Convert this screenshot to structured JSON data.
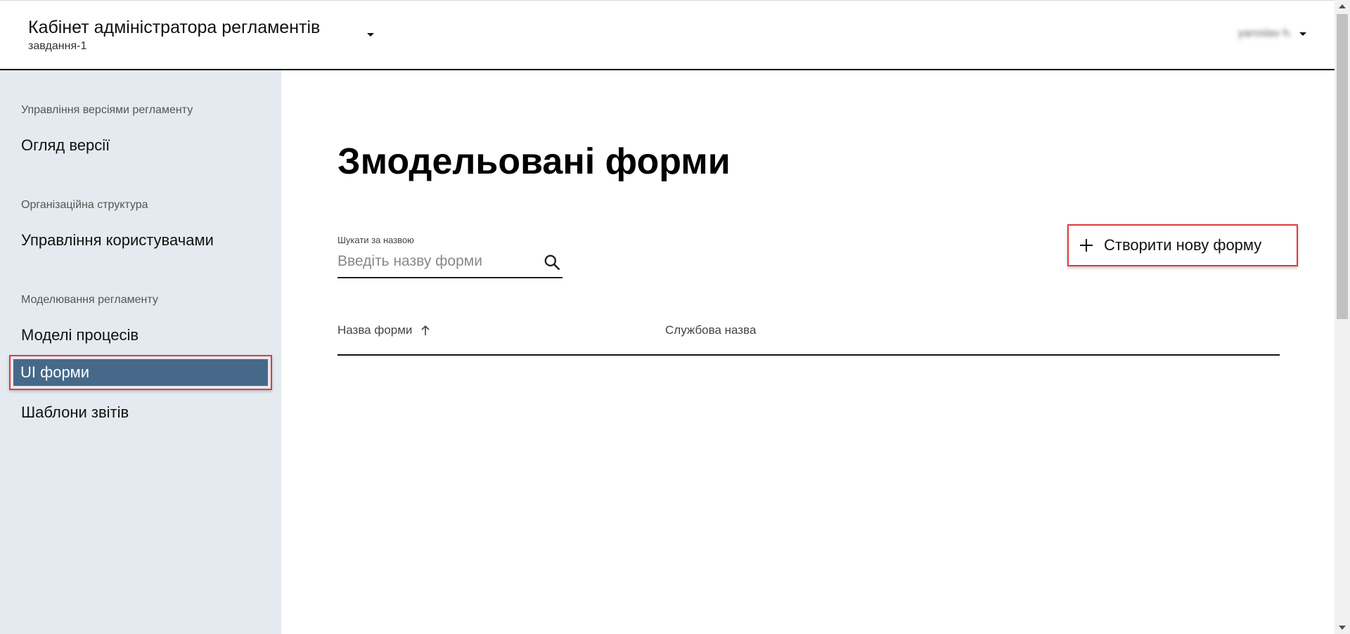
{
  "header": {
    "title": "Кабінет адміністратора регламентів",
    "subtitle": "завдання-1",
    "user_name": "yaroslav h."
  },
  "sidebar": {
    "sections": [
      {
        "title": "Управління версіями регламенту",
        "items": [
          "Огляд версії"
        ]
      },
      {
        "title": "Організаційна структура",
        "items": [
          "Управління користувачами"
        ]
      },
      {
        "title": "Моделювання регламенту",
        "items": [
          "Моделі процесів",
          "UI форми",
          "Шаблони звітів"
        ]
      }
    ],
    "active_item": "UI форми"
  },
  "main": {
    "page_title": "Змодельовані форми",
    "search": {
      "label": "Шукати за назвою",
      "placeholder": "Введіть назву форми",
      "value": ""
    },
    "create_button": "Створити нову форму",
    "table": {
      "columns": [
        "Назва форми",
        "Службова назва"
      ],
      "sort_column": "Назва форми",
      "sort_direction": "asc",
      "rows": []
    }
  },
  "colors": {
    "sidebar_bg": "#e4eaf0",
    "active_bg": "#46698a",
    "highlight_border": "#e23b3b"
  }
}
